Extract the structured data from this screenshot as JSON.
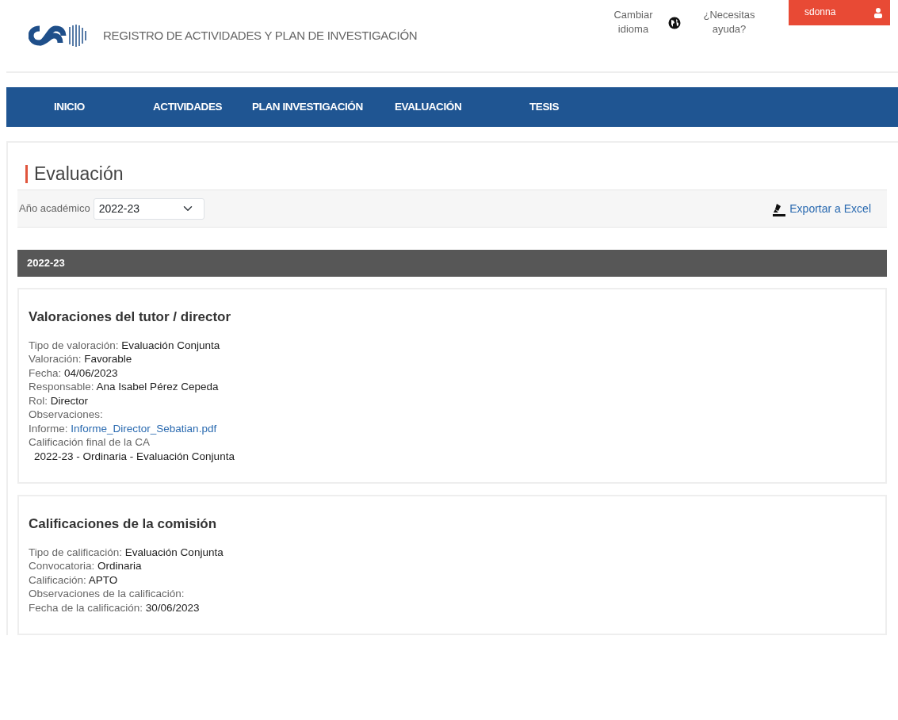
{
  "header": {
    "title": "REGISTRO DE ACTIVIDADES Y PLAN DE INVESTIGACIÓN",
    "language_link": "Cambiar idioma",
    "help_link": "¿Necesitas ayuda?",
    "user": "sdonna"
  },
  "nav": [
    "INICIO",
    "ACTIVIDADES",
    "PLAN INVESTIGACIÓN",
    "EVALUACIÓN",
    "TESIS"
  ],
  "page_title": "Evaluación",
  "filter": {
    "label": "Año académico",
    "value": "2022-23"
  },
  "export_link": "Exportar a Excel",
  "year_bar": "2022-23",
  "sections": [
    {
      "title": "Valoraciones del tutor / director",
      "fields": [
        {
          "kind": "text",
          "label": "Tipo de valoración:",
          "value": "Evaluación Conjunta"
        },
        {
          "kind": "text",
          "label": "Valoración:",
          "value": "Favorable"
        },
        {
          "kind": "text",
          "label": "Fecha:",
          "value": "04/06/2023"
        },
        {
          "kind": "text",
          "label": "Responsable:",
          "value": "Ana Isabel Pérez Cepeda"
        },
        {
          "kind": "text",
          "label": "Rol:",
          "value": "Director"
        },
        {
          "kind": "text",
          "label": "Observaciones:"
        },
        {
          "kind": "link",
          "label": "Informe:",
          "value": "Informe_Director_Sebatian.pdf"
        },
        {
          "kind": "text",
          "label": "Calificación final de la CA"
        },
        {
          "kind": "sub",
          "value": "2022-23 - Ordinaria - Evaluación Conjunta"
        }
      ]
    },
    {
      "title": "Calificaciones de la comisión",
      "fields": [
        {
          "kind": "text",
          "label": "Tipo de calificación:",
          "value": "Evaluación Conjunta"
        },
        {
          "kind": "text",
          "label": "Convocatoria:",
          "value": "Ordinaria"
        },
        {
          "kind": "text",
          "label": "Calificación:",
          "value": "APTO"
        },
        {
          "kind": "text",
          "label": "Observaciones de la calificación:"
        },
        {
          "kind": "text",
          "label": "Fecha de la calificación:",
          "value": "30/06/2023"
        }
      ]
    }
  ]
}
